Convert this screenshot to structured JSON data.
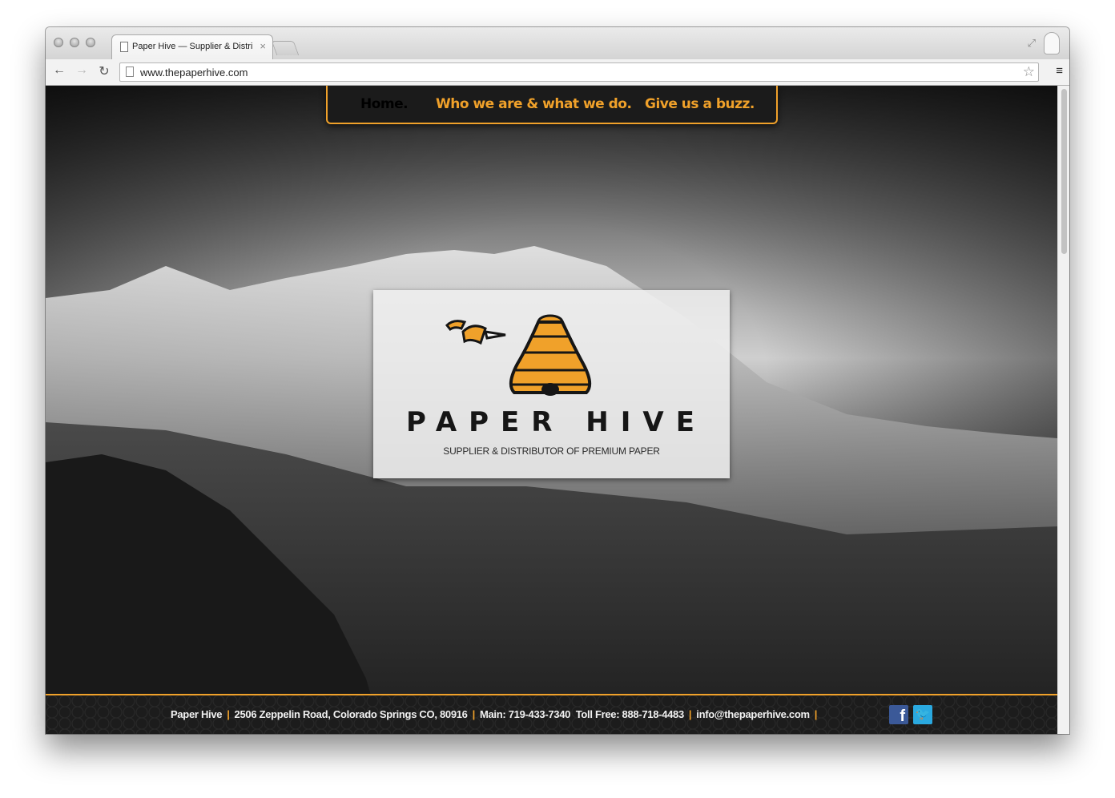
{
  "browser": {
    "tab_title": "Paper Hive — Supplier & Distributor of Premium Paper",
    "url": "www.thepaperhive.com",
    "tab_close_glyph": "×",
    "back_glyph": "←",
    "forward_glyph": "→",
    "reload_glyph": "↻",
    "star_glyph": "☆",
    "menu_glyph": "≡",
    "fullscreen_glyph": "⤢"
  },
  "nav": {
    "items": [
      {
        "label": "Home.",
        "color": "#ffffff"
      },
      {
        "label": "Who we are & what we do.",
        "color": "#f0a12a"
      },
      {
        "label": "Give us a buzz.",
        "color": "#f0a12a"
      }
    ]
  },
  "logo": {
    "brand": "PAPER HIVE",
    "tagline": "SUPPLIER & DISTRIBUTOR OF PREMIUM PAPER"
  },
  "footer": {
    "company": "Paper Hive",
    "address": "2506 Zeppelin Road, Colorado Springs CO, 80916",
    "main_phone": "Main: 719-433-7340",
    "toll_free": "Toll Free: 888-718-4483",
    "email": "info@thepaperhive.com",
    "separator": "|",
    "social": [
      {
        "name": "facebook-icon",
        "glyph": "f"
      },
      {
        "name": "twitter-icon",
        "glyph": "🐦"
      }
    ]
  },
  "colors": {
    "accent": "#f0a12a",
    "nav_bg": "#1b1b1b"
  }
}
